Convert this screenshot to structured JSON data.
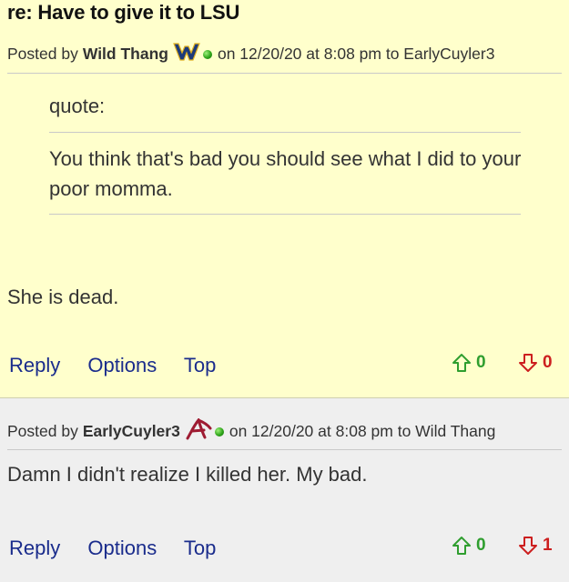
{
  "thread": {
    "title": "re: Have to give it to LSU"
  },
  "colors": {
    "post_bg": "#ffffcc",
    "reply_bg": "#efefef",
    "link": "#1a2c8c",
    "upvote": "#2f9e2f",
    "downvote": "#cc1f1f",
    "online": "#2fa51a"
  },
  "posts": [
    {
      "posted_by_label": "Posted by",
      "author": "Wild Thang",
      "team_icon": "wvu-flying-wv-logo",
      "meta": "on 12/20/20 at 8:08 pm to EarlyCuyler3",
      "quote_label": "quote:",
      "quote_text": "You think that's bad you should see what I did to your poor momma.",
      "text": "She is dead.",
      "actions": {
        "reply": "Reply",
        "options": "Options",
        "top": "Top"
      },
      "upvotes": "0",
      "downvotes": "0"
    },
    {
      "posted_by_label": "Posted by",
      "author": "EarlyCuyler3",
      "team_icon": "alabama-script-a-logo",
      "meta": "on 12/20/20 at 8:08 pm to Wild Thang",
      "text": "Damn I didn't realize I killed her. My bad.",
      "actions": {
        "reply": "Reply",
        "options": "Options",
        "top": "Top"
      },
      "upvotes": "0",
      "downvotes": "1"
    }
  ]
}
